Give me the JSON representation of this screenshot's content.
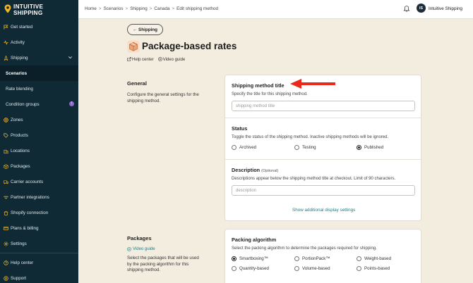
{
  "brand": {
    "line1": "INTUITIVE",
    "line2": "SHIPPING",
    "accent": "#f5b51b"
  },
  "sidebar": {
    "items": [
      {
        "label": "Get started",
        "icon": "flag-icon"
      },
      {
        "label": "Activity",
        "icon": "activity-icon"
      },
      {
        "label": "Shipping",
        "icon": "shipping-icon"
      },
      {
        "label": "Scenarios"
      },
      {
        "label": "Rate blending"
      },
      {
        "label": "Condition groups",
        "badge": "!"
      },
      {
        "label": "Zones",
        "icon": "globe-icon"
      },
      {
        "label": "Products",
        "icon": "tag-icon"
      },
      {
        "label": "Locations",
        "icon": "building-icon"
      },
      {
        "label": "Packages",
        "icon": "box-icon"
      },
      {
        "label": "Carrier accounts",
        "icon": "truck-icon"
      },
      {
        "label": "Partner integrations",
        "icon": "handshake-icon"
      },
      {
        "label": "Shopify connection",
        "icon": "shopify-icon"
      },
      {
        "label": "Plans & billing",
        "icon": "card-icon"
      },
      {
        "label": "Settings",
        "icon": "gear-icon"
      },
      {
        "label": "Help center",
        "icon": "help-icon"
      },
      {
        "label": "Support",
        "icon": "support-icon"
      }
    ]
  },
  "topbar": {
    "breadcrumb": [
      "Home",
      "Scenarios",
      "Shipping",
      "Canada",
      "Edit shipping method"
    ],
    "separator": ">",
    "avatar_initials": "IS",
    "user_name": "Intuitive Shipping"
  },
  "page": {
    "back_label": "← Shipping",
    "title": "Package-based rates",
    "help_center": "Help center",
    "video_guide": "Video guide"
  },
  "general": {
    "title": "General",
    "desc": "Configure the general settings for the shipping method."
  },
  "method_title": {
    "title": "Shipping method title",
    "desc": "Specify the title for this shipping method.",
    "placeholder": "shipping method title"
  },
  "status": {
    "title": "Status",
    "desc": "Toggle the status of the shipping method. Inactive shipping methods will be ignored.",
    "options": [
      "Archived",
      "Testing",
      "Published"
    ],
    "selected": "Published"
  },
  "description": {
    "title": "Description",
    "optional": "(Optional)",
    "desc": "Descriptions appear below the shipping method title at checkout. Limit of 90 characters.",
    "placeholder": "description",
    "more_link": "Show additional display settings"
  },
  "packages": {
    "title": "Packages",
    "video_guide": "Video guide",
    "desc": "Select the packages that will be used by the packing algorithm for this shipping method."
  },
  "packing": {
    "title": "Packing algorithm",
    "desc": "Select the packing algorithm to determine the packages required for shipping.",
    "options": [
      "Smartboxing™",
      "PortionPack™",
      "Weight-based",
      "Quantity-based",
      "Volume-based",
      "Points-based"
    ],
    "selected": "Smartboxing™"
  },
  "colors": {
    "sidebar": "#0f2a35",
    "background": "#f3ede0",
    "link": "#1a7f86",
    "arrow": "#e8291c"
  }
}
